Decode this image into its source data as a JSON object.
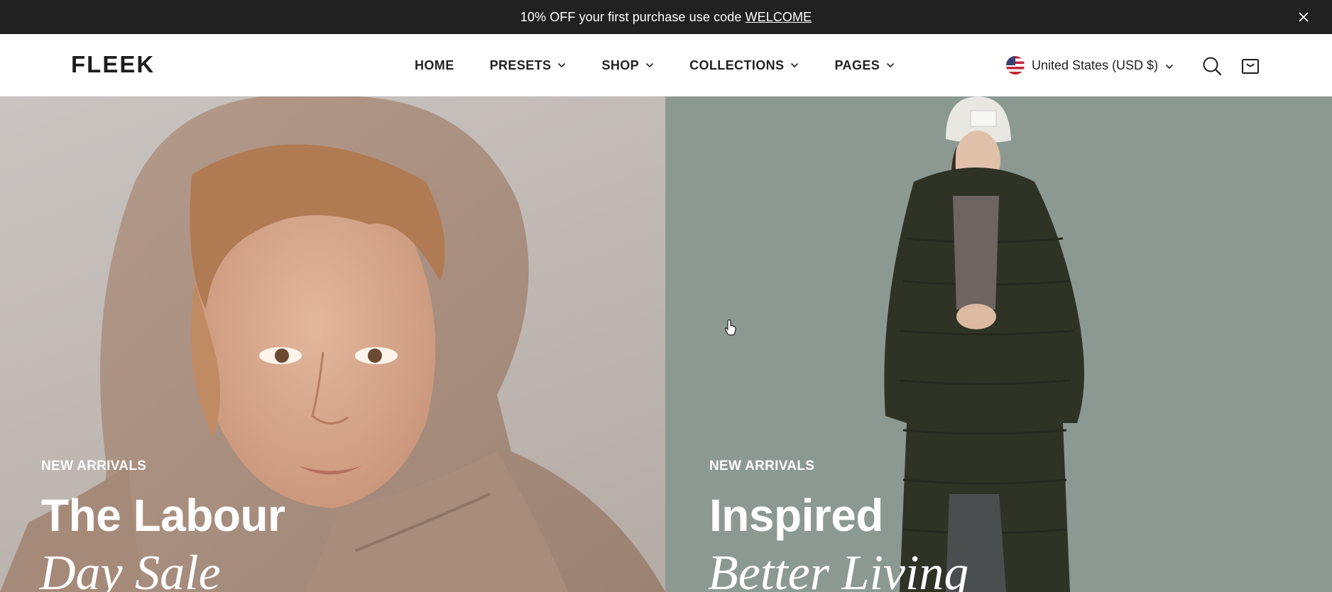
{
  "announcement": {
    "text": "10% OFF your first purchase use code",
    "code": "WELCOME",
    "close_icon": "close-icon"
  },
  "header": {
    "logo": "FLEEK",
    "nav": [
      {
        "label": "HOME",
        "dropdown": false
      },
      {
        "label": "PRESETS",
        "dropdown": true
      },
      {
        "label": "SHOP",
        "dropdown": true
      },
      {
        "label": "COLLECTIONS",
        "dropdown": true
      },
      {
        "label": "PAGES",
        "dropdown": true
      }
    ],
    "currency": {
      "label": "United States (USD $)",
      "flag_icon": "us-flag-icon"
    },
    "icons": [
      "search-icon",
      "cart-icon"
    ]
  },
  "hero": {
    "left": {
      "eyebrow": "NEW ARRIVALS",
      "title": "The Labour",
      "title_italic": "Day Sale",
      "background": "#c3bcb8"
    },
    "right": {
      "eyebrow": "NEW ARRIVALS",
      "title": "Inspired",
      "title_italic": "Better Living",
      "background": "#8c9993"
    }
  },
  "colors": {
    "announcement_bg": "#212121",
    "text_dark": "#222222",
    "hero_text": "#ffffff"
  }
}
